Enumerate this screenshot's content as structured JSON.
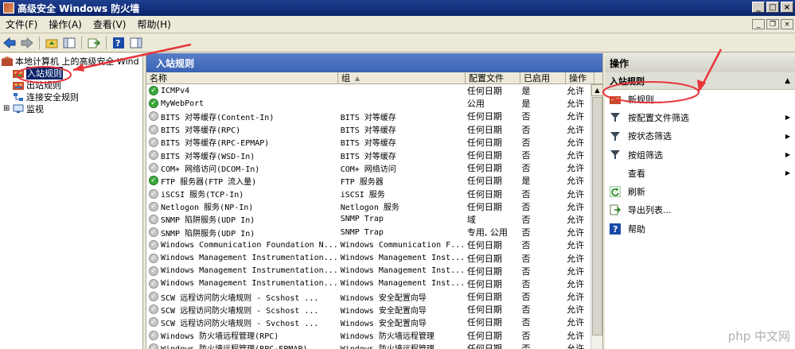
{
  "window": {
    "title": "高级安全 Windows 防火墙"
  },
  "menu": [
    "文件(F)",
    "操作(A)",
    "查看(V)",
    "帮助(H)"
  ],
  "tree": [
    {
      "label": "本地计算机 上的高级安全 Wind",
      "level": 0,
      "icon": "firewall-icon",
      "selected": false
    },
    {
      "label": "入站规则",
      "level": 1,
      "icon": "inbound-rules-icon",
      "selected": true
    },
    {
      "label": "出站规则",
      "level": 1,
      "icon": "outbound-rules-icon",
      "selected": false
    },
    {
      "label": "连接安全规则",
      "level": 1,
      "icon": "connection-security-icon",
      "selected": false
    },
    {
      "label": "监视",
      "level": 1,
      "icon": "monitor-icon",
      "selected": false,
      "expander": "⊞"
    }
  ],
  "center": {
    "title": "入站规则",
    "columns": [
      "名称",
      "组",
      "配置文件",
      "已启用",
      "操作"
    ],
    "rows": [
      {
        "name": "ICMPv4",
        "group": "",
        "profile": "任何日期",
        "enabled": "是",
        "action": "允许",
        "on": true
      },
      {
        "name": "MyWebPort",
        "group": "",
        "profile": "公用",
        "enabled": "是",
        "action": "允许",
        "on": true
      },
      {
        "name": "BITS 对等缓存(Content-In)",
        "group": "BITS 对等缓存",
        "profile": "任何日期",
        "enabled": "否",
        "action": "允许",
        "on": false
      },
      {
        "name": "BITS 对等缓存(RPC)",
        "group": "BITS 对等缓存",
        "profile": "任何日期",
        "enabled": "否",
        "action": "允许",
        "on": false
      },
      {
        "name": "BITS 对等缓存(RPC-EPMAP)",
        "group": "BITS 对等缓存",
        "profile": "任何日期",
        "enabled": "否",
        "action": "允许",
        "on": false
      },
      {
        "name": "BITS 对等缓存(WSD-In)",
        "group": "BITS 对等缓存",
        "profile": "任何日期",
        "enabled": "否",
        "action": "允许",
        "on": false
      },
      {
        "name": "COM+ 网络访问(DCOM-In)",
        "group": "COM+ 网络访问",
        "profile": "任何日期",
        "enabled": "否",
        "action": "允许",
        "on": false
      },
      {
        "name": "FTP 服务器(FTP 流入量)",
        "group": "FTP 服务器",
        "profile": "任何日期",
        "enabled": "是",
        "action": "允许",
        "on": true
      },
      {
        "name": "iSCSI 服务(TCP-In)",
        "group": "iSCSI 服务",
        "profile": "任何日期",
        "enabled": "否",
        "action": "允许",
        "on": false
      },
      {
        "name": "Netlogon 服务(NP-In)",
        "group": "Netlogon 服务",
        "profile": "任何日期",
        "enabled": "否",
        "action": "允许",
        "on": false
      },
      {
        "name": "SNMP 陷阱服务(UDP In)",
        "group": "SNMP Trap",
        "profile": "域",
        "enabled": "否",
        "action": "允许",
        "on": false
      },
      {
        "name": "SNMP 陷阱服务(UDP In)",
        "group": "SNMP Trap",
        "profile": "专用, 公用",
        "enabled": "否",
        "action": "允许",
        "on": false
      },
      {
        "name": "Windows Communication Foundation N...",
        "group": "Windows Communication F...",
        "profile": "任何日期",
        "enabled": "否",
        "action": "允许",
        "on": false
      },
      {
        "name": "Windows Management Instrumentation...",
        "group": "Windows Management Inst...",
        "profile": "任何日期",
        "enabled": "否",
        "action": "允许",
        "on": false
      },
      {
        "name": "Windows Management Instrumentation...",
        "group": "Windows Management Inst...",
        "profile": "任何日期",
        "enabled": "否",
        "action": "允许",
        "on": false
      },
      {
        "name": "Windows Management Instrumentation...",
        "group": "Windows Management Inst...",
        "profile": "任何日期",
        "enabled": "否",
        "action": "允许",
        "on": false
      },
      {
        "name": "SCW 远程访问防火墙规则 - Scshost ...",
        "group": "Windows 安全配置向导",
        "profile": "任何日期",
        "enabled": "否",
        "action": "允许",
        "on": false
      },
      {
        "name": "SCW 远程访问防火墙规则 - Scshost ...",
        "group": "Windows 安全配置向导",
        "profile": "任何日期",
        "enabled": "否",
        "action": "允许",
        "on": false
      },
      {
        "name": "SCW 远程访问防火墙规则 - Svchost ...",
        "group": "Windows 安全配置向导",
        "profile": "任何日期",
        "enabled": "否",
        "action": "允许",
        "on": false
      },
      {
        "name": "Windows 防火墙远程管理(RPC)",
        "group": "Windows 防火墙远程管理",
        "profile": "任何日期",
        "enabled": "否",
        "action": "允许",
        "on": false
      },
      {
        "name": "Windows 防火墙远程管理(RPC-EPMAP)",
        "group": "Windows 防火墙远程管理",
        "profile": "任何日期",
        "enabled": "否",
        "action": "允许",
        "on": false
      }
    ]
  },
  "actions": {
    "title": "操作",
    "section": "入站规则",
    "items": [
      {
        "label": "新规则...",
        "icon": "new-rule-icon",
        "submenu": false
      },
      {
        "label": "按配置文件筛选",
        "icon": "filter-icon",
        "submenu": true
      },
      {
        "label": "按状态筛选",
        "icon": "filter-icon",
        "submenu": true
      },
      {
        "label": "按组筛选",
        "icon": "filter-icon",
        "submenu": true
      },
      {
        "label": "查看",
        "icon": "",
        "submenu": true
      },
      {
        "label": "刷新",
        "icon": "refresh-icon",
        "submenu": false
      },
      {
        "label": "导出列表...",
        "icon": "export-icon",
        "submenu": false
      },
      {
        "label": "帮助",
        "icon": "help-icon",
        "submenu": false
      }
    ]
  },
  "watermark": "php 中文网",
  "colors": {
    "title_bar": "#0a246a",
    "annotation": "#e8353a",
    "enabled_green": "#3ca83c"
  }
}
